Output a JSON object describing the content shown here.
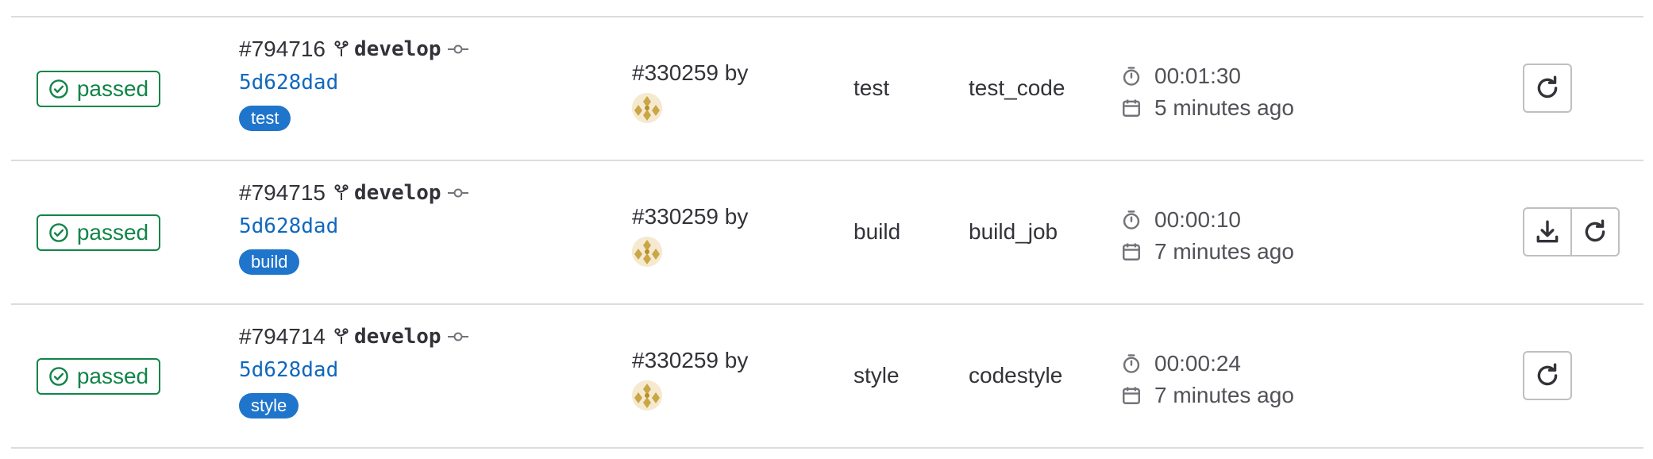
{
  "jobs": [
    {
      "status_label": "passed",
      "job_id": "#794716",
      "branch": "develop",
      "commit_sha": "5d628dad",
      "stage_badge": "test",
      "pipeline_text": "#330259 by",
      "stage": "test",
      "name": "test_code",
      "duration": "00:01:30",
      "finished": "5 minutes ago",
      "actions": [
        "retry"
      ]
    },
    {
      "status_label": "passed",
      "job_id": "#794715",
      "branch": "develop",
      "commit_sha": "5d628dad",
      "stage_badge": "build",
      "pipeline_text": "#330259 by",
      "stage": "build",
      "name": "build_job",
      "duration": "00:00:10",
      "finished": "7 minutes ago",
      "actions": [
        "download-artifacts",
        "retry"
      ]
    },
    {
      "status_label": "passed",
      "job_id": "#794714",
      "branch": "develop",
      "commit_sha": "5d628dad",
      "stage_badge": "style",
      "pipeline_text": "#330259 by",
      "stage": "style",
      "name": "codestyle",
      "duration": "00:00:24",
      "finished": "7 minutes ago",
      "actions": [
        "retry"
      ]
    }
  ],
  "icons": {
    "status": "check-circle-icon",
    "branch": "branch-icon",
    "commit": "commit-icon",
    "duration": "timer-icon",
    "finished": "calendar-icon",
    "retry": "retry-icon",
    "download": "download-icon"
  },
  "colors": {
    "success": "#108548",
    "link": "#1068bf",
    "badge": "#1f75cb",
    "border": "#dcdcde"
  }
}
